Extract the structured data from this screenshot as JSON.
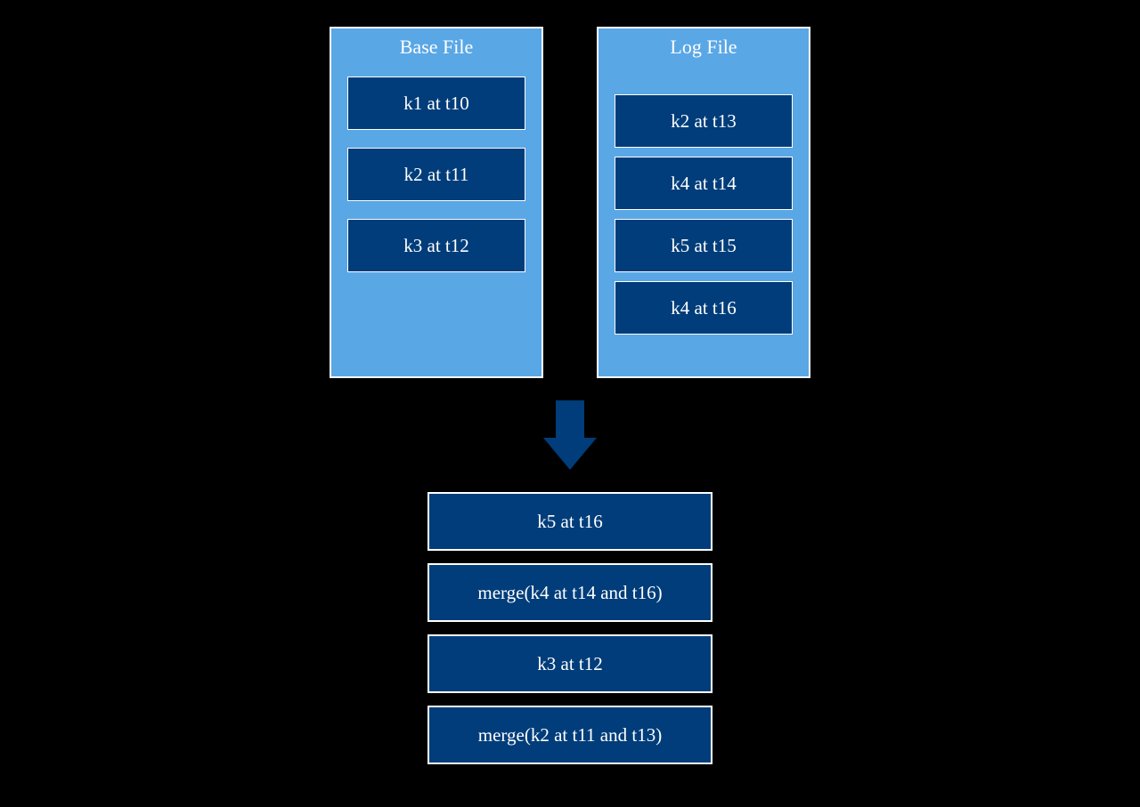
{
  "baseFile": {
    "title": "Base File",
    "entries": [
      "k1 at t10",
      "k2 at t11",
      "k3 at t12"
    ]
  },
  "logFile": {
    "title": "Log File",
    "entries": [
      "k2 at t13",
      "k4 at t14",
      "k5 at t15",
      "k4 at t16"
    ]
  },
  "result": {
    "entries": [
      "k5 at t16",
      "merge(k4 at t14 and t16)",
      "k3 at t12",
      "merge(k2 at t11 and t13)"
    ]
  },
  "colors": {
    "lightBlue": "#5aa7e6",
    "darkBlue": "#003d7a",
    "arrowBlue": "#003d7a"
  }
}
